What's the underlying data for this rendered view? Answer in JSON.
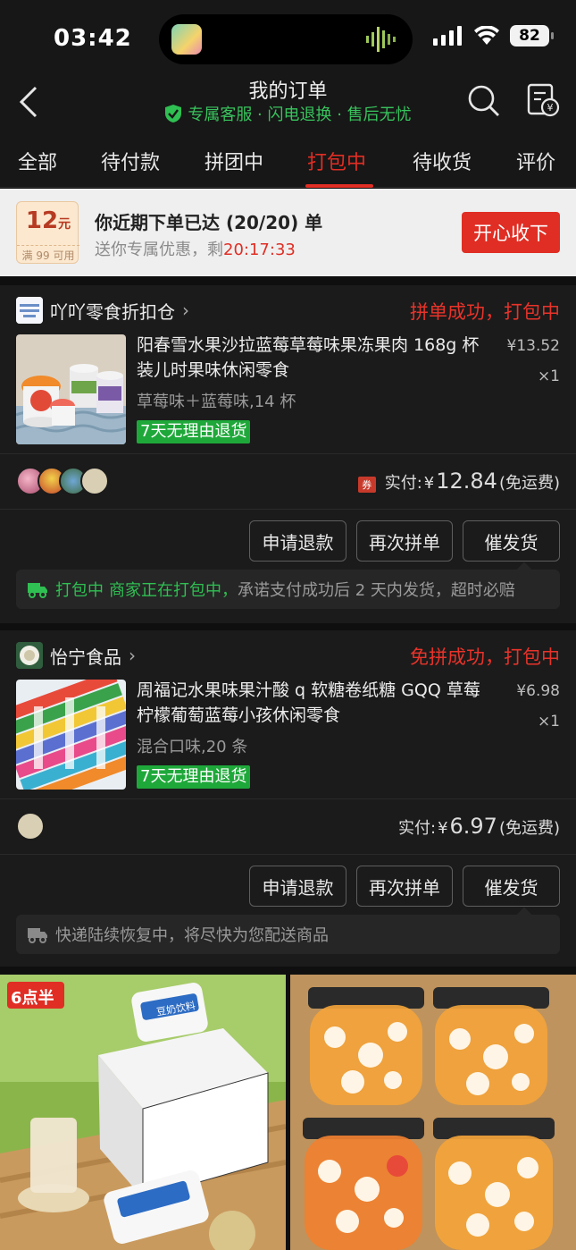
{
  "status_bar": {
    "time": "03:42",
    "battery": "82"
  },
  "header": {
    "title": "我的订单",
    "subtitle": "专属客服 · 闪电退换 · 售后无忧"
  },
  "tabs": [
    {
      "label": "全部"
    },
    {
      "label": "待付款"
    },
    {
      "label": "拼团中"
    },
    {
      "label": "打包中",
      "active": true
    },
    {
      "label": "待收货"
    },
    {
      "label": "评价"
    }
  ],
  "banner": {
    "coupon_value": "12",
    "coupon_unit": "元",
    "coupon_condition": "满 99 可用",
    "main": "你近期下单已达 (20/20) 单",
    "sub_prefix": "送你专属优惠，剩",
    "countdown": "20:17:33",
    "button": "开心收下"
  },
  "orders": [
    {
      "shop_name": "吖吖零食折扣仓",
      "shop_logo_text": "吖吖零食折扣仓",
      "status": "拼单成功，打包中",
      "product_name": "阳春雪水果沙拉蓝莓草莓味果冻果肉 168g 杯装儿时果味休闲零食",
      "spec": "草莓味＋蓝莓味,14 杯",
      "return_tag": "7天无理由退货",
      "price": "¥13.52",
      "qty": "×1",
      "coupon_icon": "券",
      "paid_label": "实付:",
      "paid_currency": "¥",
      "paid_amount": "12.84",
      "shipping": "(免运费)",
      "buttons": [
        "申请退款",
        "再次拼单",
        "催发货"
      ],
      "note_status": "打包中",
      "note_highlight": "商家正在打包中，",
      "note_text": "承诺支付成功后 2 天内发货，超时必赔"
    },
    {
      "shop_name": "怡宁食品",
      "status": "免拼成功，打包中",
      "product_name": "周福记水果味果汁酸 q 软糖卷纸糖 GQQ 草莓柠檬葡萄蓝莓小孩休闲零食",
      "spec": "混合口味,20 条",
      "return_tag": "7天无理由退货",
      "price": "¥6.98",
      "qty": "×1",
      "paid_label": "实付:",
      "paid_currency": "¥",
      "paid_amount": "6.97",
      "shipping": "(免运费)",
      "buttons": [
        "申请退款",
        "再次拼单",
        "催发货"
      ],
      "note_text": "快递陆续恢复中，将尽快为您配送商品"
    }
  ],
  "recommendations": [
    {
      "brand": "6点半",
      "package_text": "豆奶饮料"
    },
    {
      "brand": ""
    }
  ],
  "colors": {
    "accent_red": "#e02e24",
    "green": "#2fbf52",
    "card_bg": "#1b1b1b"
  },
  "icons": [
    "back-icon",
    "search-icon",
    "receipt-icon",
    "shield-check-icon",
    "truck-icon",
    "coupon-icon"
  ]
}
